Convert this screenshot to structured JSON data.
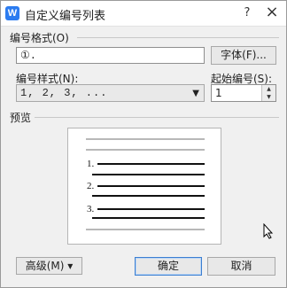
{
  "window": {
    "title": "自定义编号列表",
    "app_icon": "W",
    "help_label": "?",
    "close_label": "×"
  },
  "number_format": {
    "label": "编号格式(O)",
    "value": "①.",
    "font_button": "字体(F)..."
  },
  "number_style": {
    "label": "编号样式(N):",
    "value": "1, 2, 3, ...",
    "dropdown_icon": "triangle-down-icon"
  },
  "start_number": {
    "label": "起始编号(S):",
    "value": "1"
  },
  "preview": {
    "label": "预览",
    "items": [
      "1.",
      "2.",
      "3."
    ]
  },
  "footer": {
    "advanced_label": "高级(M) ▾",
    "ok_label": "确定",
    "cancel_label": "取消"
  },
  "colors": {
    "accent": "#2c7cf0",
    "focus_border": "#3c7fd1"
  }
}
